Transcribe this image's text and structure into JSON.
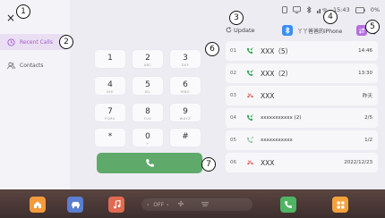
{
  "left_panel": {
    "nav": [
      {
        "label": "Recent Calls",
        "icon": "clock-icon",
        "active": true
      },
      {
        "label": "Contacts",
        "icon": "contacts-icon",
        "active": false
      }
    ]
  },
  "badges": [
    "1",
    "2",
    "3",
    "4",
    "5",
    "6",
    "7"
  ],
  "status_bar": {
    "time": "15:43",
    "battery": "0%"
  },
  "toolbar": {
    "update_label": "Update",
    "device_name": "丫丫爸爸的iPhone"
  },
  "keypad": [
    {
      "digit": "1",
      "letters": ""
    },
    {
      "digit": "2",
      "letters": "ABC"
    },
    {
      "digit": "3",
      "letters": "DEF"
    },
    {
      "digit": "4",
      "letters": "GHI"
    },
    {
      "digit": "5",
      "letters": "JKL"
    },
    {
      "digit": "6",
      "letters": "MNO"
    },
    {
      "digit": "7",
      "letters": "PQRS"
    },
    {
      "digit": "8",
      "letters": "TUV"
    },
    {
      "digit": "9",
      "letters": "WXYZ"
    },
    {
      "digit": "*",
      "letters": ""
    },
    {
      "digit": "0",
      "letters": "+"
    },
    {
      "digit": "#",
      "letters": ""
    }
  ],
  "calls": [
    {
      "index": "01",
      "type": "incoming",
      "name": "XXX（5）",
      "time": "14:46"
    },
    {
      "index": "02",
      "type": "incoming",
      "name": "XXX（2）",
      "time": "13:30"
    },
    {
      "index": "03",
      "type": "missed",
      "name": "XXX",
      "time": "昨天"
    },
    {
      "index": "04",
      "type": "incoming",
      "name": "xxxxxxxxxxx (2)",
      "time": "2/5"
    },
    {
      "index": "05",
      "type": "outgoing",
      "name": "xxxxxxxxxxx",
      "time": "1/2"
    },
    {
      "index": "06",
      "type": "missed",
      "name": "XXX",
      "time": "2022/12/23"
    }
  ],
  "dock": {
    "climate_label": "OFF"
  },
  "colors": {
    "accent": "#a05ad0",
    "call_green": "#5fa96b",
    "missed_red": "#e0504a",
    "bluetooth": "#3a8ef2"
  }
}
